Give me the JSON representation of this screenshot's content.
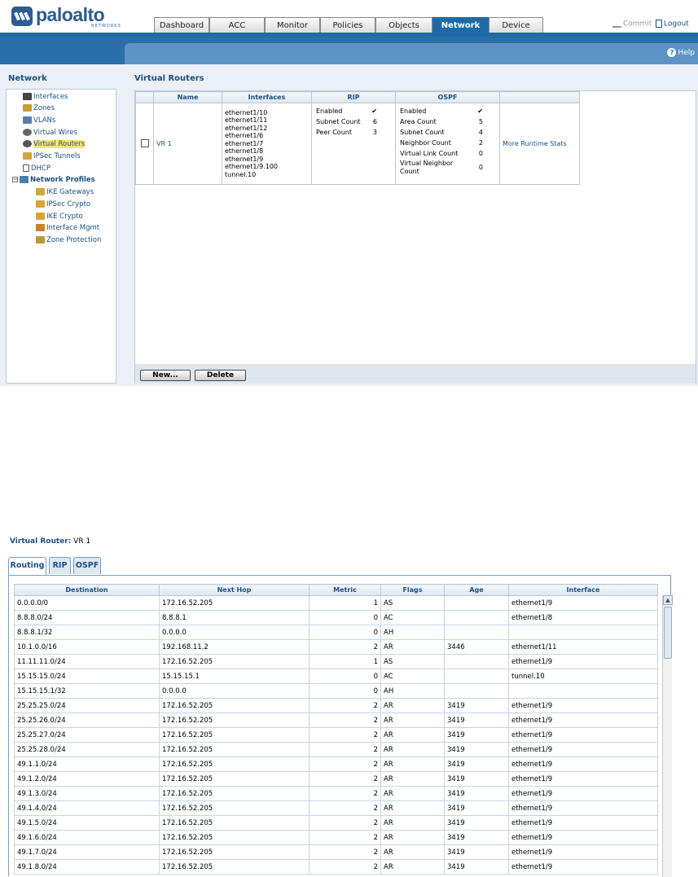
{
  "header": {
    "brand": "paloalto",
    "brand_sub": "NETWORKS",
    "tabs": [
      "Dashboard",
      "ACC",
      "Monitor",
      "Policies",
      "Objects",
      "Network",
      "Device"
    ],
    "active_tab": "Network",
    "commit_label": "Commit",
    "logout_label": "Logout",
    "help_label": "Help"
  },
  "sidebar": {
    "title": "Network",
    "items": [
      {
        "label": "Interfaces",
        "icon": "interfaces-icon"
      },
      {
        "label": "Zones",
        "icon": "zones-icon"
      },
      {
        "label": "VLANs",
        "icon": "vlans-icon"
      },
      {
        "label": "Virtual Wires",
        "icon": "virtual-wires-icon"
      },
      {
        "label": "Virtual Routers",
        "icon": "virtual-routers-icon"
      },
      {
        "label": "IPSec Tunnels",
        "icon": "ipsec-tunnels-icon"
      },
      {
        "label": "DHCP",
        "icon": "dhcp-icon"
      },
      {
        "label": "Network Profiles",
        "icon": "network-profiles-icon"
      },
      {
        "label": "IKE Gateways",
        "icon": "ike-gateways-icon"
      },
      {
        "label": "IPSec Crypto",
        "icon": "lock-icon"
      },
      {
        "label": "IKE Crypto",
        "icon": "lock-icon"
      },
      {
        "label": "Interface Mgmt",
        "icon": "interface-mgmt-icon"
      },
      {
        "label": "Zone Protection",
        "icon": "zone-protection-icon"
      }
    ],
    "selected": "Virtual Routers"
  },
  "main": {
    "title": "Virtual Routers",
    "columns": {
      "name": "Name",
      "interfaces": "Interfaces",
      "rip": "RIP",
      "ospf": "OSPF"
    },
    "router": {
      "name": "VR 1",
      "interfaces": [
        "ethernet1/10",
        "ethernet1/11",
        "ethernet1/12",
        "ethernet1/6",
        "ethernet1/7",
        "ethernet1/8",
        "ethernet1/9",
        "ethernet1/9.100",
        "tunnel.10"
      ],
      "rip": [
        {
          "k": "Enabled",
          "v": "✔"
        },
        {
          "k": "Subnet Count",
          "v": "6"
        },
        {
          "k": "Peer Count",
          "v": "3"
        }
      ],
      "ospf": [
        {
          "k": "Enabled",
          "v": "✔"
        },
        {
          "k": "Area Count",
          "v": "5"
        },
        {
          "k": "Subnet Count",
          "v": "4"
        },
        {
          "k": "Neighbor Count",
          "v": "2"
        },
        {
          "k": "Virtual Link Count",
          "v": "0"
        },
        {
          "k": "Virtual Neighbor Count",
          "v": "0"
        }
      ],
      "runtime_link": "More Runtime Stats"
    },
    "new_button": "New...",
    "delete_button": "Delete"
  },
  "runtime": {
    "label": "Virtual Router:",
    "router_name": "VR 1",
    "tabs": [
      "Routing",
      "RIP",
      "OSPF"
    ],
    "active_tab": "Routing",
    "headers": [
      "Destination",
      "Next Hop",
      "Metric",
      "Flags",
      "Age",
      "Interface"
    ],
    "rows": [
      [
        "0.0.0.0/0",
        "172.16.52.205",
        "1",
        "AS",
        "",
        "ethernet1/9"
      ],
      [
        "8.8.8.0/24",
        "8.8.8.1",
        "0",
        "AC",
        "",
        "ethernet1/8"
      ],
      [
        "8.8.8.1/32",
        "0.0.0.0",
        "0",
        "AH",
        "",
        ""
      ],
      [
        "10.1.0.0/16",
        "192.168.11.2",
        "2",
        "AR",
        "3446",
        "ethernet1/11"
      ],
      [
        "11.11.11.0/24",
        "172.16.52.205",
        "1",
        "AS",
        "",
        "ethernet1/9"
      ],
      [
        "15.15.15.0/24",
        "15.15.15.1",
        "0",
        "AC",
        "",
        "tunnel.10"
      ],
      [
        "15.15.15.1/32",
        "0.0.0.0",
        "0",
        "AH",
        "",
        ""
      ],
      [
        "25.25.25.0/24",
        "172.16.52.205",
        "2",
        "AR",
        "3419",
        "ethernet1/9"
      ],
      [
        "25.25.26.0/24",
        "172.16.52.205",
        "2",
        "AR",
        "3419",
        "ethernet1/9"
      ],
      [
        "25.25.27.0/24",
        "172.16.52.205",
        "2",
        "AR",
        "3419",
        "ethernet1/9"
      ],
      [
        "25.25.28.0/24",
        "172.16.52.205",
        "2",
        "AR",
        "3419",
        "ethernet1/9"
      ],
      [
        "49.1.1.0/24",
        "172.16.52.205",
        "2",
        "AR",
        "3419",
        "ethernet1/9"
      ],
      [
        "49.1.2.0/24",
        "172.16.52.205",
        "2",
        "AR",
        "3419",
        "ethernet1/9"
      ],
      [
        "49.1.3.0/24",
        "172.16.52.205",
        "2",
        "AR",
        "3419",
        "ethernet1/9"
      ],
      [
        "49.1.4.0/24",
        "172.16.52.205",
        "2",
        "AR",
        "3419",
        "ethernet1/9"
      ],
      [
        "49.1.5.0/24",
        "172.16.52.205",
        "2",
        "AR",
        "3419",
        "ethernet1/9"
      ],
      [
        "49.1.6.0/24",
        "172.16.52.205",
        "2",
        "AR",
        "3419",
        "ethernet1/9"
      ],
      [
        "49.1.7.0/24",
        "172.16.52.205",
        "2",
        "AR",
        "3419",
        "ethernet1/9"
      ],
      [
        "49.1.8.0/24",
        "172.16.52.205",
        "2",
        "AR",
        "3419",
        "ethernet1/9"
      ]
    ]
  },
  "colors": {
    "brand": "#2d5c8f",
    "accent": "#1f6aa5",
    "link": "#1d4f80",
    "highlight": "#f5e27a"
  }
}
